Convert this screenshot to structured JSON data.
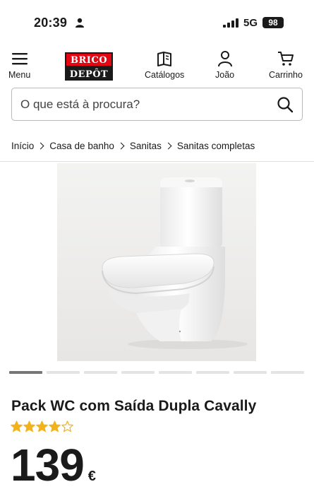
{
  "status_bar": {
    "time": "20:39",
    "network": "5G",
    "battery": "98"
  },
  "header": {
    "menu_label": "Menu",
    "logo_top": "BRICO",
    "logo_bottom": "DEPÔT",
    "catalog_label": "Catálogos",
    "account_label": "João",
    "cart_label": "Carrinho"
  },
  "search": {
    "placeholder": "O que está à procura?"
  },
  "breadcrumb": [
    "Início",
    "Casa de banho",
    "Sanitas",
    "Sanitas completas"
  ],
  "carousel": {
    "total": 8,
    "active_index": 0
  },
  "product": {
    "title": "Pack WC com Saída Dupla Cavally",
    "rating": 4,
    "rating_max": 5,
    "price_integer": "139",
    "currency": "€"
  },
  "colors": {
    "brand_red": "#e30613",
    "star": "#f2b21b",
    "text": "#1a1a1a"
  }
}
